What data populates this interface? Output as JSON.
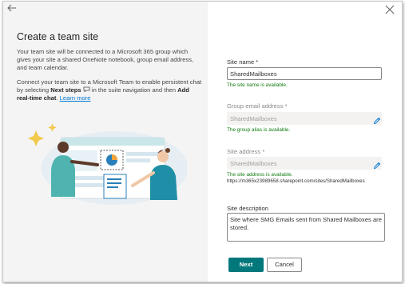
{
  "panel": {
    "title": "Create a team site",
    "intro": "Your team site will be connected to a Microsoft 365 group which gives your site a shared OneNote notebook, group email address, and team calendar.",
    "teams_part1": "Connect your team site to a Microsoft Team to enable persistent chat by selecting ",
    "teams_bold1": "Next steps",
    "teams_part2": " in the suite navigation and then ",
    "teams_bold2": "Add real-time chat",
    "teams_part3": ". ",
    "learn_more": "Learn more"
  },
  "form": {
    "site_name_label": "Site name *",
    "site_name_value": "SharedMailboxes",
    "site_name_status": "The site name is available.",
    "group_email_label": "Group email address *",
    "group_email_value": "SharedMailboxes",
    "group_email_status": "The group alias is available.",
    "site_address_label": "Site address *",
    "site_address_value": "SharedMailboxes",
    "site_address_status": "The site address is available.",
    "site_address_url": "https://m365x23989658.sharepoint.com/sites/SharedMailboxes",
    "description_label": "Site description",
    "description_value": "Site where SMG Emails sent from Shared Mailboxes are stored.",
    "next_label": "Next",
    "cancel_label": "Cancel"
  },
  "colors": {
    "primary": "#03787c",
    "success": "#107c10",
    "link": "#0078d4",
    "panel_bg": "#f4f4f4"
  },
  "icons": {
    "back": "back-arrow-icon",
    "close": "close-icon",
    "edit": "pencil-icon",
    "chat": "chat-bubble-icon"
  }
}
